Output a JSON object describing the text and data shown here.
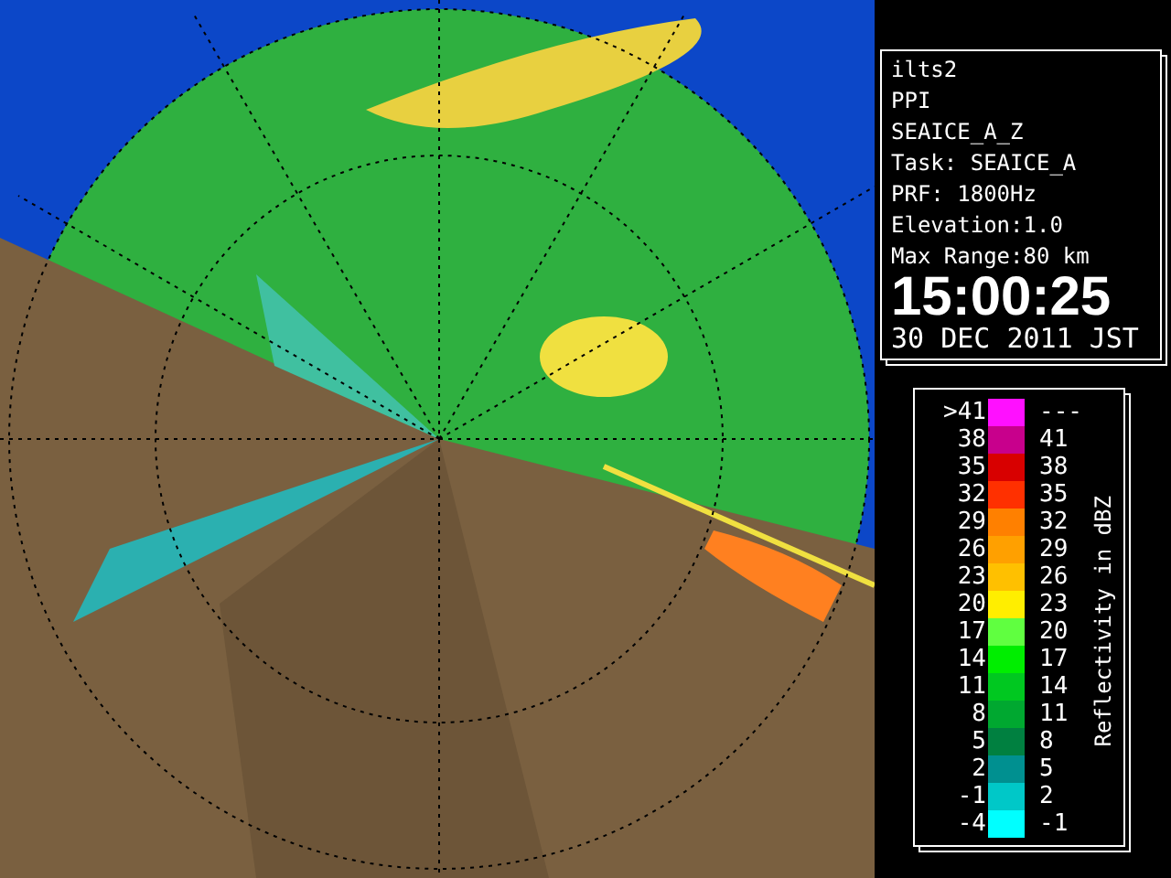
{
  "info_panel": {
    "lines": [
      "ilts2",
      "PPI",
      "SEAICE_A_Z",
      "Task: SEAICE_A",
      "PRF: 1800Hz",
      "Elevation:1.0",
      "Max Range:80 km"
    ],
    "time": "15:00:25",
    "date": "30 DEC 2011 JST"
  },
  "legend": {
    "title": "Reflectivity in dBZ",
    "rows": [
      {
        "low": ">41",
        "high": "---",
        "color": "#ff10ff"
      },
      {
        "low": "38",
        "high": "41",
        "color": "#c8008c"
      },
      {
        "low": "35",
        "high": "38",
        "color": "#d80000"
      },
      {
        "low": "32",
        "high": "35",
        "color": "#ff3000"
      },
      {
        "low": "29",
        "high": "32",
        "color": "#ff8000"
      },
      {
        "low": "26",
        "high": "29",
        "color": "#ffa000"
      },
      {
        "low": "23",
        "high": "26",
        "color": "#ffc000"
      },
      {
        "low": "20",
        "high": "23",
        "color": "#ffee00"
      },
      {
        "low": "17",
        "high": "20",
        "color": "#60ff40"
      },
      {
        "low": "14",
        "high": "17",
        "color": "#00ee00"
      },
      {
        "low": "11",
        "high": "14",
        "color": "#00c820"
      },
      {
        "low": "8",
        "high": "11",
        "color": "#00a830"
      },
      {
        "low": "5",
        "high": "8",
        "color": "#008040"
      },
      {
        "low": "2",
        "high": "5",
        "color": "#009090"
      },
      {
        "low": "-1",
        "high": "2",
        "color": "#00c8c8"
      },
      {
        "low": "-4",
        "high": "-1",
        "color": "#00ffff"
      }
    ]
  }
}
